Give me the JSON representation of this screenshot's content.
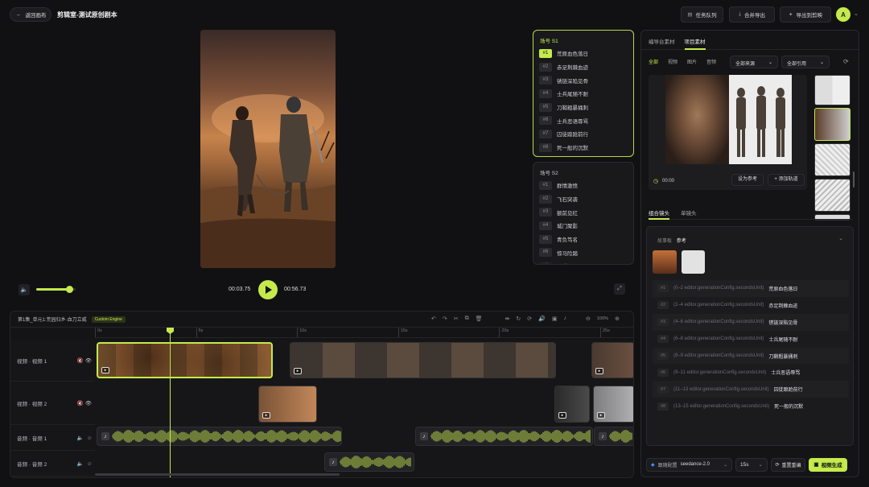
{
  "header": {
    "back_label": "返回画布",
    "title": "剪辑室-测试原创剧本",
    "task_queue": "任务队列",
    "merge_export": "合并导出",
    "export_to_editor": "导出到剪映",
    "avatar_initial": "A"
  },
  "player": {
    "current_time": "00:03.75",
    "total_time": "00:56.73",
    "volume_level": 0.83
  },
  "scene1": {
    "title": "场号 S1",
    "items": [
      {
        "num": "#1",
        "label": "荒原血色落日"
      },
      {
        "num": "#2",
        "label": "赤足荆棘血迹"
      },
      {
        "num": "#3",
        "label": "锈链深陷见骨"
      },
      {
        "num": "#4",
        "label": "士兵尾随不耐"
      },
      {
        "num": "#5",
        "label": "刀鞘粗暴捅刺"
      },
      {
        "num": "#6",
        "label": "士兵恶语辱骂"
      },
      {
        "num": "#7",
        "label": "囚徒踉跄前行"
      },
      {
        "num": "#8",
        "label": "死一般的沉默"
      }
    ]
  },
  "scene2": {
    "title": "场号 S2",
    "items": [
      {
        "num": "#1",
        "label": "群情激愤"
      },
      {
        "num": "#2",
        "label": "飞石突袭"
      },
      {
        "num": "#3",
        "label": "额前见红"
      },
      {
        "num": "#4",
        "label": "城门聚影"
      },
      {
        "num": "#5",
        "label": "青负笃名"
      },
      {
        "num": "#6",
        "label": "惊马险踏"
      },
      {
        "num": "#7",
        "label": "可望可及"
      }
    ]
  },
  "timeline": {
    "episode_title": "第1集_单元1:荒园归乡·血刀立威",
    "engine_badge": "Custom Engine",
    "zoom": "100%",
    "ruler": [
      "0s",
      "5s",
      "10s",
      "15s",
      "20s",
      "25s"
    ],
    "tracks": [
      "视频 · 视频 1",
      "视频 · 视频 2",
      "音频 · 音频 1",
      "音频 · 音频 2"
    ]
  },
  "assets": {
    "tabs": [
      "编导台素材",
      "项目素材"
    ],
    "filters": [
      "全部",
      "视频",
      "图片",
      "音频"
    ],
    "source_select": "全部来源",
    "ref_select": "全部引用",
    "preview_time": "00:00",
    "set_reference": "设为参考",
    "add_track": "+ 添加轨道"
  },
  "shots": {
    "tabs": [
      "组合镜头",
      "单镜头"
    ],
    "storyboard_label": "故事板",
    "storyboard_value": "参考",
    "items": [
      {
        "num": "#1",
        "meta": "(0–2 editor.generationConfig.secondsUnit)",
        "title": "荒原血色落日"
      },
      {
        "num": "#2",
        "meta": "(2–4 editor.generationConfig.secondsUnit)",
        "title": "赤足荆棘血迹"
      },
      {
        "num": "#3",
        "meta": "(4–6 editor.generationConfig.secondsUnit)",
        "title": "锈链深陷见骨"
      },
      {
        "num": "#4",
        "meta": "(6–8 editor.generationConfig.secondsUnit)",
        "title": "士兵尾随不耐"
      },
      {
        "num": "#5",
        "meta": "(8–9 editor.generationConfig.secondsUnit)",
        "title": "刀鞘粗暴捅刺"
      },
      {
        "num": "#6",
        "meta": "(9–11 editor.generationConfig.secondsUnit)",
        "title": "士兵恶语辱骂"
      },
      {
        "num": "#7",
        "meta": "(11–13 editor.generationConfig.secondsUnit)",
        "title": "囚徒踉跄前行"
      },
      {
        "num": "#8",
        "meta": "(13–15 editor.generationConfig.secondsUnit)",
        "title": "死一般的沉默"
      }
    ]
  },
  "footer": {
    "config_label": "跟随配置",
    "model": "seedance-2.0",
    "duration": "15s",
    "reedit": "重置重编",
    "generate": "视频生成"
  },
  "colors": {
    "accent": "#c4ea4c",
    "bg": "#111113",
    "panel": "#19191c"
  }
}
